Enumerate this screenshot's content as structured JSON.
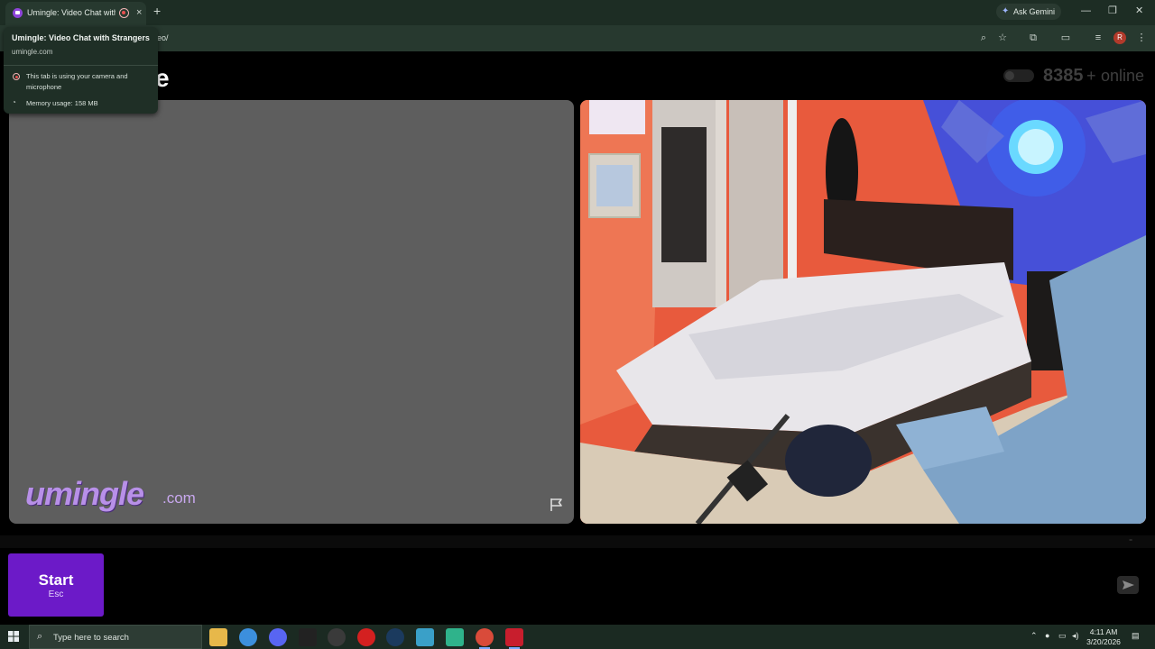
{
  "browser": {
    "tab_title": "Umingle: Video Chat with Strangers",
    "new_tab": "+",
    "close_tab": "×",
    "ask_gemini": "Ask Gemini",
    "url_visible_fragment": "eo/",
    "profile_initial": "R",
    "window_controls": {
      "minimize": "—",
      "restore": "❐",
      "close": "✕"
    }
  },
  "hover_card": {
    "title": "Umingle: Video Chat with Strangers",
    "domain": "umingle.com",
    "camera_notice": "This tab is using your camera and microphone",
    "memory": "Memory usage: 158 MB"
  },
  "site": {
    "logo_fragment": "e",
    "online_count": "8385",
    "online_plus": "+",
    "online_label": "online",
    "wordmark": "umingle",
    "wordmark_suffix": ".com"
  },
  "controls": {
    "start_label": "Start",
    "start_key": "Esc"
  },
  "taskbar": {
    "search_placeholder": "Type here to search",
    "time": "4:11 AM",
    "date": "3/20/2026"
  },
  "colors": {
    "brand_purple": "#6c1ac8",
    "wordmark_lavender": "#b890e8",
    "stranger_video_bg": "#5e5e5e",
    "page_bg": "#000000"
  },
  "icons": [
    "umingle-favicon-icon",
    "recording-icon",
    "close-icon",
    "plus-icon",
    "gemini-spark-icon",
    "zoom-icon",
    "star-icon",
    "extensions-icon",
    "cast-icon",
    "media-icon",
    "menu-icon",
    "report-flag-icon",
    "send-icon",
    "windows-start-icon",
    "search-icon"
  ]
}
